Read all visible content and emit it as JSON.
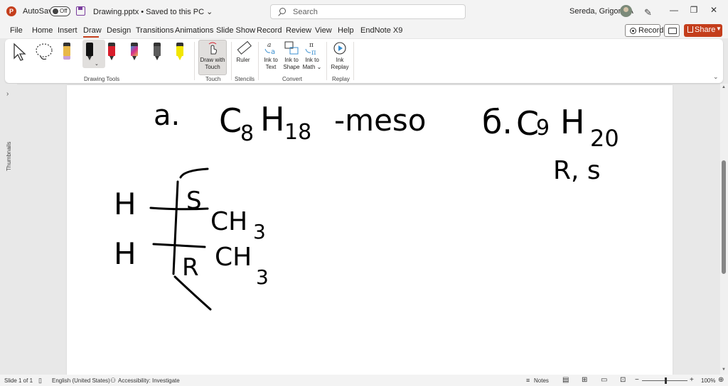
{
  "titlebar": {
    "autosave_label": "AutoSave",
    "autosave_state": "Off",
    "document_title": "Drawing.pptx • Saved to this PC ⌄",
    "search_placeholder": "Search",
    "user_name": "Sereda, Grigoriy A"
  },
  "menu": {
    "tabs": [
      "File",
      "Home",
      "Insert",
      "Draw",
      "Design",
      "Transitions",
      "Animations",
      "Slide Show",
      "Record",
      "Review",
      "View",
      "Help",
      "EndNote X9"
    ],
    "active_tab": "Draw",
    "record_label": "Record",
    "share_label": "Share"
  },
  "ribbon": {
    "groups": {
      "drawing_tools": "Drawing Tools",
      "touch": "Touch",
      "stencils": "Stencils",
      "convert": "Convert",
      "replay": "Replay"
    },
    "buttons": {
      "draw_with_touch_line1": "Draw with",
      "draw_with_touch_line2": "Touch",
      "ruler": "Ruler",
      "ink_to_text_line1": "Ink to",
      "ink_to_text_line2": "Text",
      "ink_to_shape_line1": "Ink to",
      "ink_to_shape_line2": "Shape",
      "ink_to_math_line1": "Ink to",
      "ink_to_math_line2": "Math ⌄",
      "ink_replay_line1": "Ink",
      "ink_replay_line2": "Replay"
    },
    "pen_colors": [
      "#e8b84a",
      "#111111",
      "#d81e2c",
      "#3a8fd0",
      "#5b5b5b",
      "#f2e600"
    ]
  },
  "sidebar": {
    "label": "Thumbnails"
  },
  "slide": {
    "ink_text": {
      "a_label": "a.",
      "c8h18": "C",
      "sub_8": "8",
      "h18": "H",
      "sub_18": "18",
      "meso": "-meso",
      "b_label": "б.",
      "c9h20": "C",
      "sub_9": "9",
      "h20": "H",
      "sub_20": "20",
      "rs": "R, s",
      "h_top": "H",
      "h_bottom": "H",
      "s_label": "S",
      "r_label": "R",
      "ch3_top": "CH",
      "sub3_top": "3",
      "ch3_bottom": "CH",
      "sub3_bottom": "3"
    }
  },
  "status": {
    "slide_info": "Slide 1 of 1",
    "language": "English (United States)",
    "accessibility": "Accessibility: Investigate",
    "notes": "Notes",
    "zoom": "100%"
  }
}
